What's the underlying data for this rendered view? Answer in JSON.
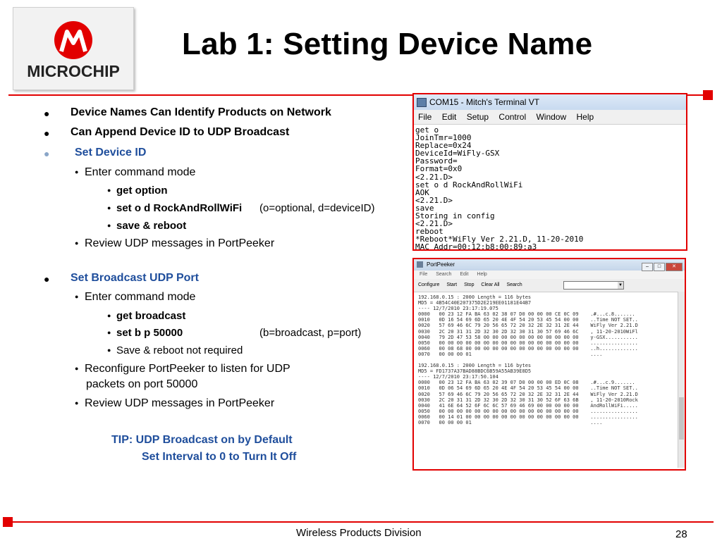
{
  "header": {
    "logo_text": "MICROCHIP",
    "title": "Lab 1: Setting Device Name"
  },
  "bullets": {
    "b1": "Device Names Can Identify Products on Network",
    "b2": "Can Append Device ID to UDP Broadcast",
    "b3": "Set Device ID",
    "b3_sub1": "Enter command mode",
    "b3_cmd1": "get option",
    "b3_cmd2": "set o d RockAndRollWiFi",
    "b3_cmd2_note": "(o=optional, d=deviceID)",
    "b3_cmd3": "save & reboot",
    "b3_sub2": "Review UDP messages in PortPeeker",
    "b4": "Set Broadcast UDP Port",
    "b4_sub1": "Enter command mode",
    "b4_cmd1": "get broadcast",
    "b4_cmd2": "set b p 50000",
    "b4_cmd2_note": "(b=broadcast, p=port)",
    "b4_cmd3": "Save & reboot not required",
    "b4_sub2_line1": "Reconfigure PortPeeker to listen for UDP",
    "b4_sub2_line2": "packets on port 50000",
    "b4_sub3": "Review UDP messages in PortPeeker"
  },
  "tip": {
    "line1": "TIP: UDP Broadcast on by Default",
    "line2": "Set Interval to 0 to Turn It Off"
  },
  "terminal": {
    "title": "COM15 - Mitch's Terminal VT",
    "menu": [
      "File",
      "Edit",
      "Setup",
      "Control",
      "Window",
      "Help"
    ],
    "lines": [
      "get o",
      "JoinTmr=1000",
      "Replace=0x24",
      "DeviceId=WiFly-GSX",
      "Password=",
      "Format=0x0",
      "<2.21.D>",
      "set o d RockAndRollWiFi",
      "AOK",
      "<2.21.D>",
      "save",
      "Storing in config",
      "<2.21.D>",
      "reboot",
      "*Reboot*WiFly Ver 2.21.D, 11-20-2010",
      "MAC Addr=00:12:b8:00:89:a3"
    ]
  },
  "portpeeker": {
    "title": "PortPeeker",
    "menu": [
      "File",
      "Search",
      "Edit",
      "Help"
    ],
    "toolbar": [
      "Configure",
      "Start",
      "Stop",
      "Clear All",
      "Search"
    ],
    "packet1": [
      "192.168.0.15 : 2000 Length = 116 bytes",
      "MD5 = 4B54C40E207375D2E219EE01181E44B7",
      "---- 12/7/2010 23:17:19.075",
      "0000   00 23 12 FA BA 63 02 38 07 D0 00 00 00 CE 0C 09    .#...c.8.......",
      "0010   0D 16 54 69 6D 65 20 4E 4F 54 20 53 45 54 00 00    ..Time NOT SET..",
      "0020   57 69 46 6C 79 20 56 65 72 20 32 2E 32 31 2E 44    WiFly Ver 2.21.D",
      "0030   2C 20 31 31 2D 32 30 2D 32 30 31 30 57 69 46 6C    , 11-20-2010WiFl",
      "0040   79 2D 47 53 58 00 00 00 00 00 00 00 00 00 00 00    y-GSX...........",
      "0050   00 00 00 00 00 00 00 00 00 00 00 00 00 00 00 00    ................",
      "0060   00 08 68 00 00 00 00 00 00 00 00 00 00 00 00 00    ..h.............",
      "0070   00 00 00 01                                        ...."
    ],
    "packet2": [
      "192.168.0.15 : 2000 Length = 116 bytes",
      "MD5 = FD1737A37BAD88BDC6B59A55AB39E8D5",
      "---- 12/7/2010 23:17:50.104",
      "0000   00 23 12 FA BA 63 02 39 07 D0 00 00 00 ED 0C 08    .#...c.9.......",
      "0010   0D 06 54 69 6D 65 20 4E 4F 54 20 53 45 54 00 00    ..Time NOT SET..",
      "0020   57 69 46 6C 79 20 56 65 72 20 32 2E 32 31 2E 44    WiFly Ver 2.21.D",
      "0030   2C 20 31 31 2D 32 30 2D 32 30 31 30 52 6F 63 6B    , 11-20-2010Rock",
      "0040   41 6E 64 52 6F 6C 6C 57 69 46 69 00 00 00 00 00    AndRollWiFi.....",
      "0050   00 00 00 00 00 00 00 00 00 00 00 00 00 00 00 00    ................",
      "0060   00 14 01 00 00 00 00 00 00 00 00 00 00 00 00 00    ................",
      "0070   00 00 00 01                                        ...."
    ]
  },
  "footer": {
    "division": "Wireless Products Division",
    "page": "28"
  },
  "colors": {
    "accent_red": "#e20000",
    "heading_blue": "#1f4e9c"
  }
}
